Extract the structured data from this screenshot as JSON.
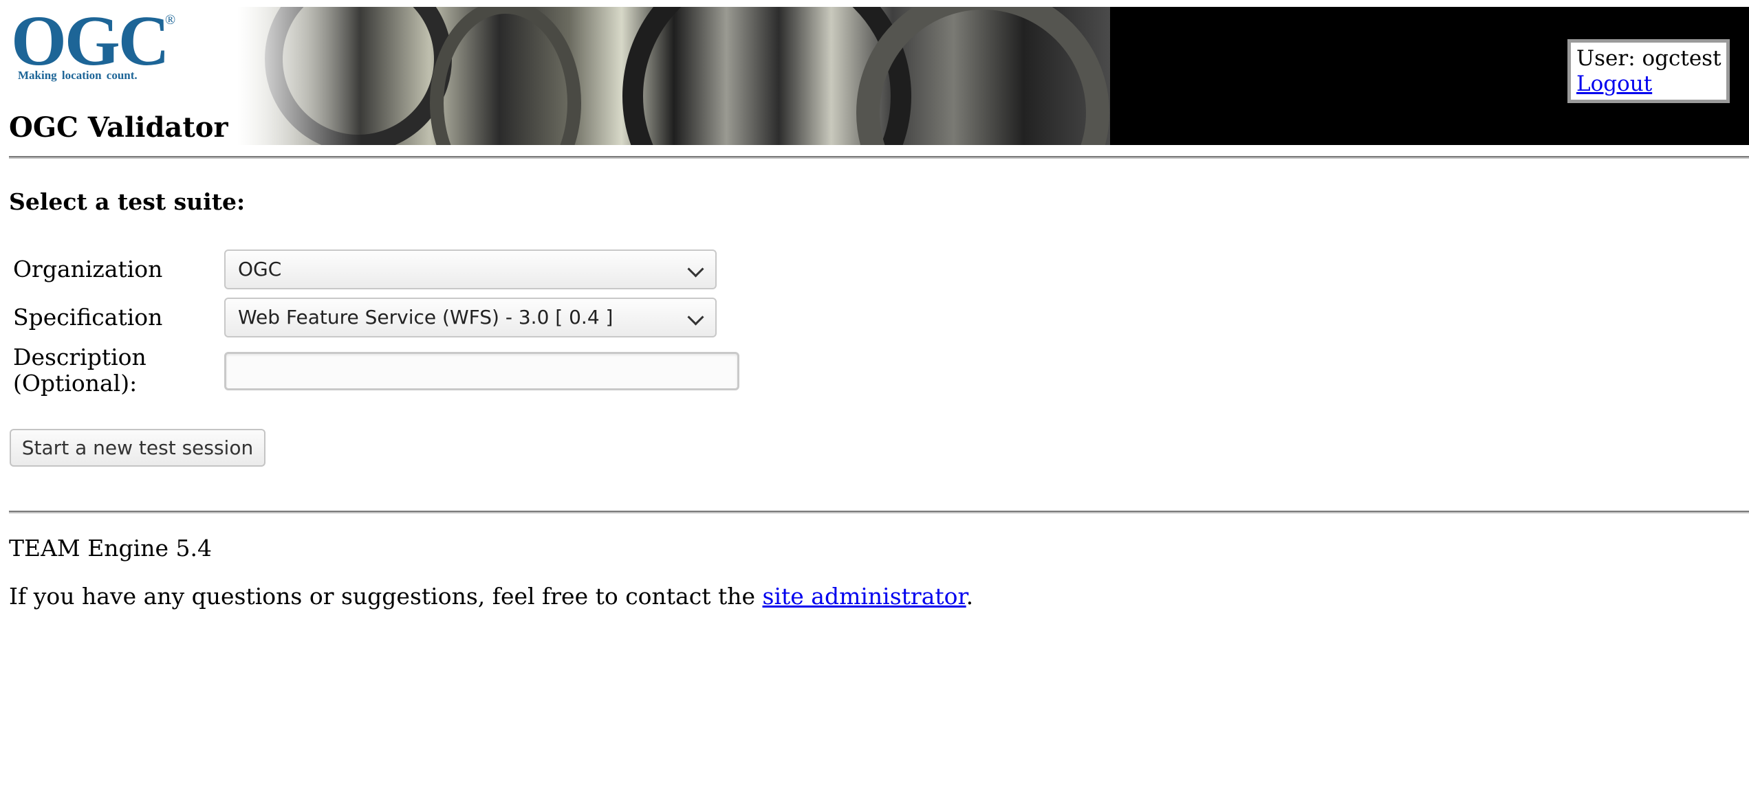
{
  "header": {
    "logo_text": "OGC",
    "logo_registered": "®",
    "logo_tagline": "Making location count.",
    "title": "OGC Validator",
    "user_label": "User: ogctest",
    "logout_link": "Logout"
  },
  "form": {
    "heading": "Select a test suite:",
    "organization_label": "Organization",
    "organization_value": "OGC",
    "specification_label": "Specification",
    "specification_value": "Web Feature Service (WFS) - 3.0 [ 0.4 ]",
    "description_label_line1": "Description",
    "description_label_line2": "(Optional):",
    "description_value": "",
    "start_button": "Start a new test session"
  },
  "footer": {
    "version": "TEAM Engine 5.4",
    "contact_prefix": "If you have any questions or suggestions, feel free to contact the ",
    "contact_link": "site administrator",
    "contact_suffix": "."
  },
  "colors": {
    "logo_blue": "#1d6597",
    "link_blue": "#0000ee",
    "banner_black": "#000000",
    "rule_gray": "#7a7a7a"
  },
  "icons": {
    "select_arrow": "chevron-down-icon"
  }
}
